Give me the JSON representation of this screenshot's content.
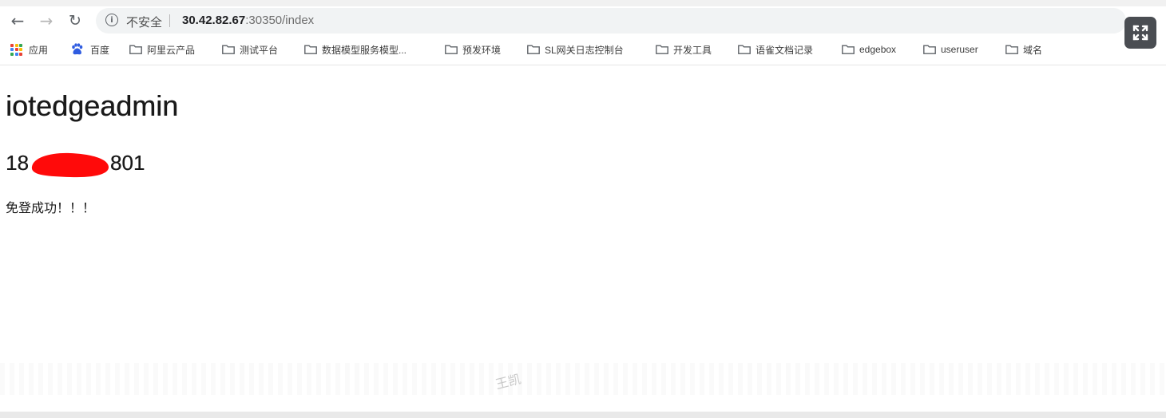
{
  "browser": {
    "address_bar": {
      "security_label": "不安全",
      "url_host": "30.42.82.67",
      "url_rest": ":30350/index"
    },
    "bookmarks": [
      {
        "label": "应用",
        "icon": "apps-grid-icon"
      },
      {
        "label": "百度",
        "icon": "baidu-paw-icon"
      },
      {
        "label": "阿里云产品",
        "icon": "folder-icon"
      },
      {
        "label": "测试平台",
        "icon": "folder-icon"
      },
      {
        "label": "数据模型服务模型...",
        "icon": "folder-icon"
      },
      {
        "label": "预发环境",
        "icon": "folder-icon"
      },
      {
        "label": "SL网关日志控制台",
        "icon": "folder-icon"
      },
      {
        "label": "开发工具",
        "icon": "folder-icon"
      },
      {
        "label": "语雀文档记录",
        "icon": "folder-icon"
      },
      {
        "label": "edgebox",
        "icon": "folder-icon"
      },
      {
        "label": "useruser",
        "icon": "folder-icon"
      },
      {
        "label": "域名",
        "icon": "folder-icon"
      }
    ]
  },
  "page": {
    "heading": "iotedgeadmin",
    "phone_prefix": "18",
    "phone_suffix": "801",
    "message": "免登成功！！！"
  },
  "watermark": "王凯",
  "colors": {
    "redaction": "#ff0a0a",
    "fullscreen_bg": "#4a4d52",
    "baidu_blue": "#2f5ce0"
  }
}
